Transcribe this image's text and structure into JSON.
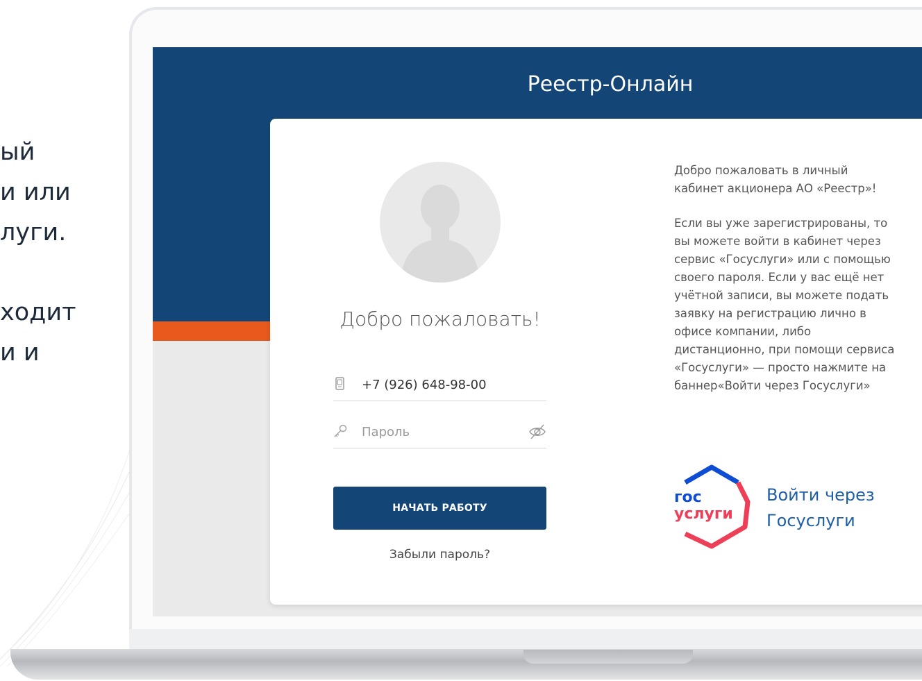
{
  "side_text": {
    "lines": [
      "ый",
      "и или",
      "луги."
    ],
    "lines2": [
      "ходит",
      "и и"
    ]
  },
  "app": {
    "title": "Реестр-Онлайн"
  },
  "login": {
    "welcome": "Добро пожаловать!",
    "phone_value": "+7 (926) 648-98-00",
    "password_placeholder": "Пароль",
    "start_button": "НАЧАТЬ РАБОТУ",
    "forgot_link": "Забыли пароль?"
  },
  "info": {
    "paragraph1": "Добро пожаловать в личный кабинет акционера АО «Реестр»!",
    "paragraph2": "Если вы уже зарегистрированы, то вы можете войти в кабинет через сервис «Госуслуги» или с помощью своего пароля. Если у вас ещё нет учётной записи, вы можете подать заявку на регистрацию лично в офисе компании, либо дистанционно, при помощи сервиса «Госуслуги» — просто нажмите на баннер«Войти через Госуслуги»"
  },
  "gosuslugi": {
    "logo_line1": "гос",
    "logo_line2": "услуги",
    "link_line1": "Войти через",
    "link_line2": "Госуслуги"
  },
  "colors": {
    "header_blue": "#134677",
    "accent_orange": "#e8591e",
    "link_blue": "#1f5fa5",
    "gos_red": "#ee3f58",
    "gos_blue": "#0d4cd3"
  },
  "icons": {
    "phone": "phone-icon",
    "key": "key-icon",
    "eye": "eye-off-icon",
    "avatar": "user-silhouette-icon"
  }
}
